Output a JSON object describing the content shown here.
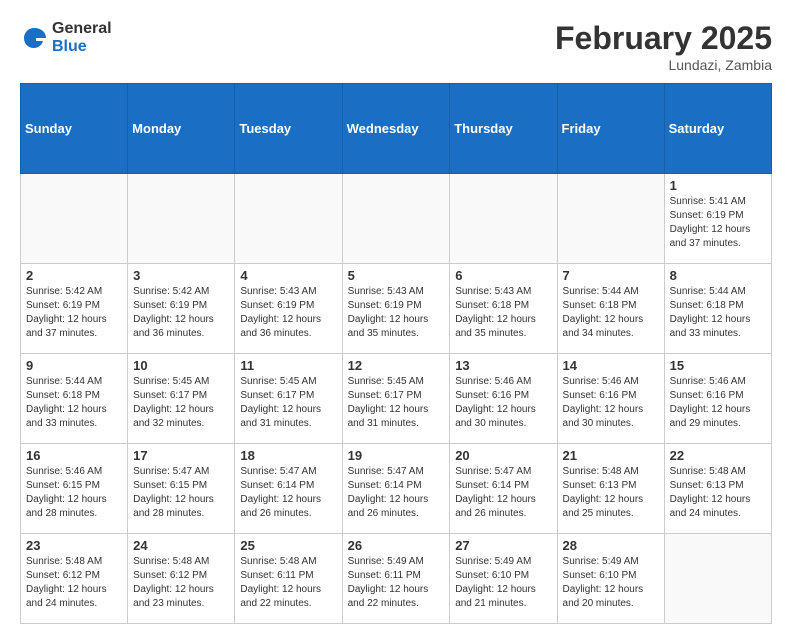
{
  "header": {
    "logo_general": "General",
    "logo_blue": "Blue",
    "month_year": "February 2025",
    "location": "Lundazi, Zambia"
  },
  "days_of_week": [
    "Sunday",
    "Monday",
    "Tuesday",
    "Wednesday",
    "Thursday",
    "Friday",
    "Saturday"
  ],
  "weeks": [
    [
      {
        "day": "",
        "info": ""
      },
      {
        "day": "",
        "info": ""
      },
      {
        "day": "",
        "info": ""
      },
      {
        "day": "",
        "info": ""
      },
      {
        "day": "",
        "info": ""
      },
      {
        "day": "",
        "info": ""
      },
      {
        "day": "1",
        "info": "Sunrise: 5:41 AM\nSunset: 6:19 PM\nDaylight: 12 hours and 37 minutes."
      }
    ],
    [
      {
        "day": "2",
        "info": "Sunrise: 5:42 AM\nSunset: 6:19 PM\nDaylight: 12 hours and 37 minutes."
      },
      {
        "day": "3",
        "info": "Sunrise: 5:42 AM\nSunset: 6:19 PM\nDaylight: 12 hours and 36 minutes."
      },
      {
        "day": "4",
        "info": "Sunrise: 5:43 AM\nSunset: 6:19 PM\nDaylight: 12 hours and 36 minutes."
      },
      {
        "day": "5",
        "info": "Sunrise: 5:43 AM\nSunset: 6:19 PM\nDaylight: 12 hours and 35 minutes."
      },
      {
        "day": "6",
        "info": "Sunrise: 5:43 AM\nSunset: 6:18 PM\nDaylight: 12 hours and 35 minutes."
      },
      {
        "day": "7",
        "info": "Sunrise: 5:44 AM\nSunset: 6:18 PM\nDaylight: 12 hours and 34 minutes."
      },
      {
        "day": "8",
        "info": "Sunrise: 5:44 AM\nSunset: 6:18 PM\nDaylight: 12 hours and 33 minutes."
      }
    ],
    [
      {
        "day": "9",
        "info": "Sunrise: 5:44 AM\nSunset: 6:18 PM\nDaylight: 12 hours and 33 minutes."
      },
      {
        "day": "10",
        "info": "Sunrise: 5:45 AM\nSunset: 6:17 PM\nDaylight: 12 hours and 32 minutes."
      },
      {
        "day": "11",
        "info": "Sunrise: 5:45 AM\nSunset: 6:17 PM\nDaylight: 12 hours and 31 minutes."
      },
      {
        "day": "12",
        "info": "Sunrise: 5:45 AM\nSunset: 6:17 PM\nDaylight: 12 hours and 31 minutes."
      },
      {
        "day": "13",
        "info": "Sunrise: 5:46 AM\nSunset: 6:16 PM\nDaylight: 12 hours and 30 minutes."
      },
      {
        "day": "14",
        "info": "Sunrise: 5:46 AM\nSunset: 6:16 PM\nDaylight: 12 hours and 30 minutes."
      },
      {
        "day": "15",
        "info": "Sunrise: 5:46 AM\nSunset: 6:16 PM\nDaylight: 12 hours and 29 minutes."
      }
    ],
    [
      {
        "day": "16",
        "info": "Sunrise: 5:46 AM\nSunset: 6:15 PM\nDaylight: 12 hours and 28 minutes."
      },
      {
        "day": "17",
        "info": "Sunrise: 5:47 AM\nSunset: 6:15 PM\nDaylight: 12 hours and 28 minutes."
      },
      {
        "day": "18",
        "info": "Sunrise: 5:47 AM\nSunset: 6:14 PM\nDaylight: 12 hours and 26 minutes."
      },
      {
        "day": "19",
        "info": "Sunrise: 5:47 AM\nSunset: 6:14 PM\nDaylight: 12 hours and 26 minutes."
      },
      {
        "day": "20",
        "info": "Sunrise: 5:47 AM\nSunset: 6:14 PM\nDaylight: 12 hours and 26 minutes."
      },
      {
        "day": "21",
        "info": "Sunrise: 5:48 AM\nSunset: 6:13 PM\nDaylight: 12 hours and 25 minutes."
      },
      {
        "day": "22",
        "info": "Sunrise: 5:48 AM\nSunset: 6:13 PM\nDaylight: 12 hours and 24 minutes."
      }
    ],
    [
      {
        "day": "23",
        "info": "Sunrise: 5:48 AM\nSunset: 6:12 PM\nDaylight: 12 hours and 24 minutes."
      },
      {
        "day": "24",
        "info": "Sunrise: 5:48 AM\nSunset: 6:12 PM\nDaylight: 12 hours and 23 minutes."
      },
      {
        "day": "25",
        "info": "Sunrise: 5:48 AM\nSunset: 6:11 PM\nDaylight: 12 hours and 22 minutes."
      },
      {
        "day": "26",
        "info": "Sunrise: 5:49 AM\nSunset: 6:11 PM\nDaylight: 12 hours and 22 minutes."
      },
      {
        "day": "27",
        "info": "Sunrise: 5:49 AM\nSunset: 6:10 PM\nDaylight: 12 hours and 21 minutes."
      },
      {
        "day": "28",
        "info": "Sunrise: 5:49 AM\nSunset: 6:10 PM\nDaylight: 12 hours and 20 minutes."
      },
      {
        "day": "",
        "info": ""
      }
    ]
  ]
}
